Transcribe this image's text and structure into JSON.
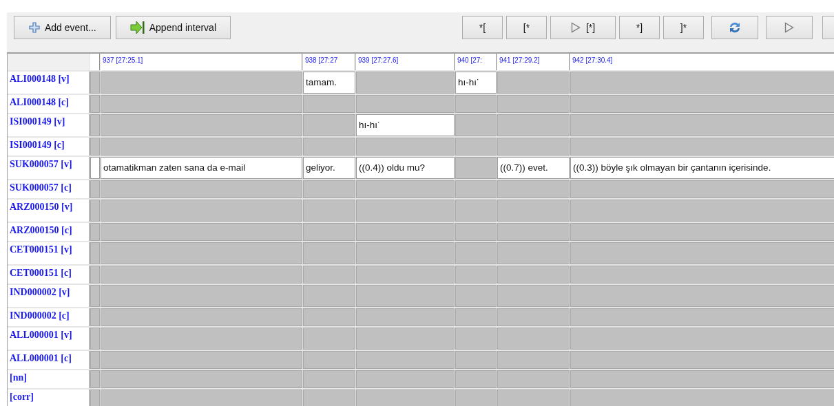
{
  "toolbar": {
    "left_buttons": [
      {
        "kind": "add",
        "label": "Add event..."
      },
      {
        "kind": "append",
        "label": "Append interval"
      }
    ],
    "right_buttons": [
      {
        "kind": "text",
        "label": "*["
      },
      {
        "kind": "text",
        "label": "[*"
      },
      {
        "kind": "play-text",
        "label": "[*]"
      },
      {
        "kind": "text",
        "label": "*]"
      },
      {
        "kind": "text",
        "label": "]*"
      },
      {
        "kind": "refresh"
      },
      {
        "kind": "play"
      },
      {
        "kind": "partial"
      }
    ]
  },
  "table": {
    "columns": [
      "",
      "937 [27:25.1]",
      "938 [27:27",
      "939 [27:27.6]",
      "940 [27:",
      "941 [27:29.2]",
      "942 [27:30.4]"
    ],
    "rows": [
      {
        "label": "ALI000148 [v]",
        "kind": "v",
        "cells": [
          {
            "event": false
          },
          {
            "event": false
          },
          {
            "event": true,
            "text": "tamam."
          },
          {
            "event": false
          },
          {
            "event": true,
            "text": "hı-hı˙"
          },
          {
            "event": false
          },
          {
            "event": false
          }
        ]
      },
      {
        "label": "ALI000148 [c]",
        "kind": "c",
        "cells": [
          {
            "event": false
          },
          {
            "event": false
          },
          {
            "event": false
          },
          {
            "event": false
          },
          {
            "event": false
          },
          {
            "event": false
          },
          {
            "event": false
          }
        ]
      },
      {
        "label": "ISI000149 [v]",
        "kind": "v",
        "cells": [
          {
            "event": false
          },
          {
            "event": false
          },
          {
            "event": false
          },
          {
            "event": true,
            "text": "hı-hı˙"
          },
          {
            "event": false
          },
          {
            "event": false
          },
          {
            "event": false
          }
        ]
      },
      {
        "label": "ISI000149 [c]",
        "kind": "c",
        "cells": [
          {
            "event": false
          },
          {
            "event": false
          },
          {
            "event": false
          },
          {
            "event": false
          },
          {
            "event": false
          },
          {
            "event": false
          },
          {
            "event": false
          }
        ]
      },
      {
        "label": "SUK000057 [v]",
        "kind": "v",
        "cells": [
          {
            "event": true
          },
          {
            "event": true,
            "text": "otamatikman zaten sana da e-mail"
          },
          {
            "event": true,
            "text": "geliyor."
          },
          {
            "event": true,
            "text": "((0.4)) oldu mu?"
          },
          {
            "event": false
          },
          {
            "event": true,
            "text": "((0.7)) evet."
          },
          {
            "event": true,
            "text": "((0.3)) böyle şık olmayan bir çantanın içerisinde."
          }
        ]
      },
      {
        "label": "SUK000057 [c]",
        "kind": "c",
        "cells": [
          {
            "event": false
          },
          {
            "event": false
          },
          {
            "event": false
          },
          {
            "event": false
          },
          {
            "event": false
          },
          {
            "event": false
          },
          {
            "event": false
          }
        ]
      },
      {
        "label": "ARZ000150 [v]",
        "kind": "v",
        "cells": [
          {
            "event": false
          },
          {
            "event": false
          },
          {
            "event": false
          },
          {
            "event": false
          },
          {
            "event": false
          },
          {
            "event": false
          },
          {
            "event": false
          }
        ]
      },
      {
        "label": "ARZ000150 [c]",
        "kind": "c",
        "cells": [
          {
            "event": false
          },
          {
            "event": false
          },
          {
            "event": false
          },
          {
            "event": false
          },
          {
            "event": false
          },
          {
            "event": false
          },
          {
            "event": false
          }
        ]
      },
      {
        "label": "CET000151 [v]",
        "kind": "v",
        "cells": [
          {
            "event": false
          },
          {
            "event": false
          },
          {
            "event": false
          },
          {
            "event": false
          },
          {
            "event": false
          },
          {
            "event": false
          },
          {
            "event": false
          }
        ]
      },
      {
        "label": "CET000151 [c]",
        "kind": "c",
        "cells": [
          {
            "event": false
          },
          {
            "event": false
          },
          {
            "event": false
          },
          {
            "event": false
          },
          {
            "event": false
          },
          {
            "event": false
          },
          {
            "event": false
          }
        ]
      },
      {
        "label": "IND000002 [v]",
        "kind": "v",
        "cells": [
          {
            "event": false
          },
          {
            "event": false
          },
          {
            "event": false
          },
          {
            "event": false
          },
          {
            "event": false
          },
          {
            "event": false
          },
          {
            "event": false
          }
        ]
      },
      {
        "label": "IND000002 [c]",
        "kind": "c",
        "cells": [
          {
            "event": false
          },
          {
            "event": false
          },
          {
            "event": false
          },
          {
            "event": false
          },
          {
            "event": false
          },
          {
            "event": false
          },
          {
            "event": false
          }
        ]
      },
      {
        "label": "ALL000001 [v]",
        "kind": "v",
        "cells": [
          {
            "event": false
          },
          {
            "event": false
          },
          {
            "event": false
          },
          {
            "event": false
          },
          {
            "event": false
          },
          {
            "event": false
          },
          {
            "event": false
          }
        ]
      },
      {
        "label": "ALL000001 [c]",
        "kind": "c",
        "cells": [
          {
            "event": false
          },
          {
            "event": false
          },
          {
            "event": false
          },
          {
            "event": false
          },
          {
            "event": false
          },
          {
            "event": false
          },
          {
            "event": false
          }
        ]
      },
      {
        "label": "[nn]",
        "kind": "c",
        "cells": [
          {
            "event": false
          },
          {
            "event": false
          },
          {
            "event": false
          },
          {
            "event": false
          },
          {
            "event": false
          },
          {
            "event": false
          },
          {
            "event": false
          }
        ]
      },
      {
        "label": "[corr]",
        "kind": "c",
        "cells": [
          {
            "event": false
          },
          {
            "event": false
          },
          {
            "event": false
          },
          {
            "event": false
          },
          {
            "event": false
          },
          {
            "event": false
          },
          {
            "event": false
          }
        ]
      }
    ]
  }
}
